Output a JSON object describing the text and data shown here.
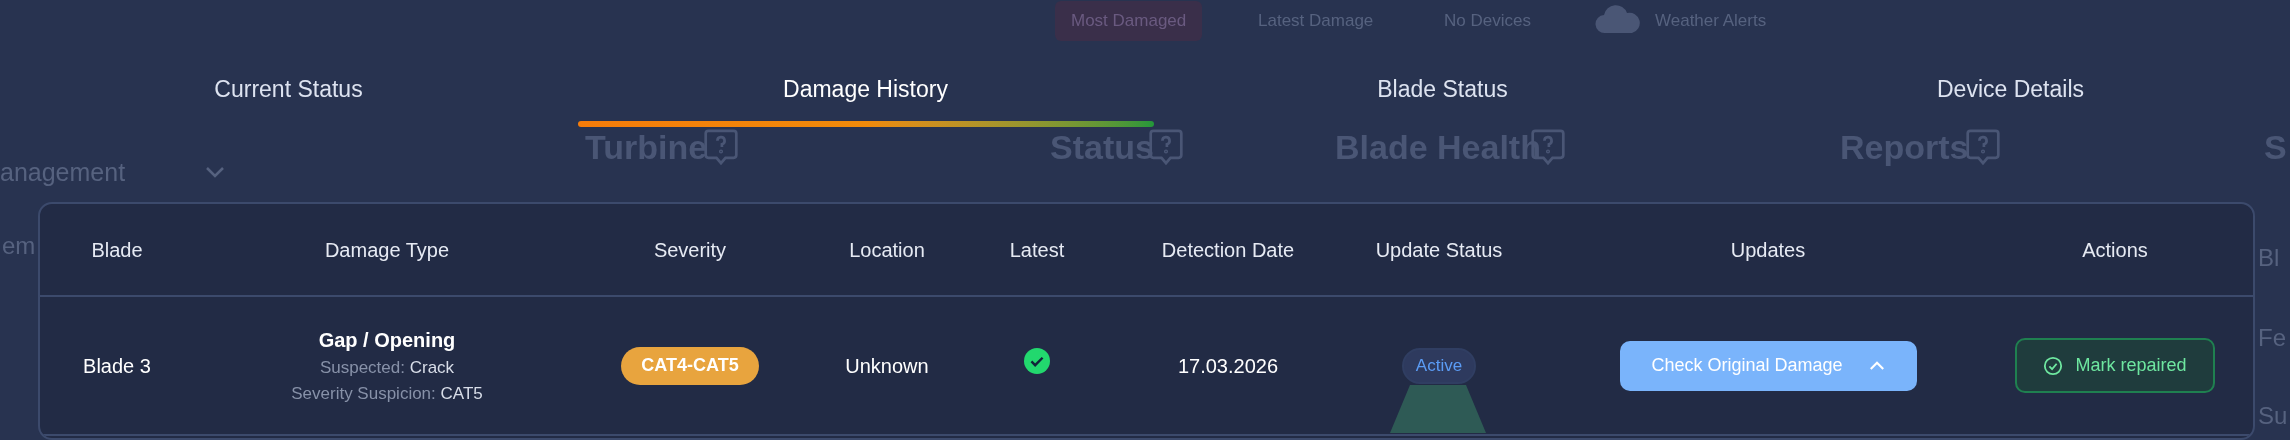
{
  "background": {
    "filters": [
      {
        "label": "Most Damaged",
        "selected": true
      },
      {
        "label": "Latest Damage",
        "selected": false
      },
      {
        "label": "No Devices",
        "selected": false
      },
      {
        "label": "Weather Alerts",
        "selected": false,
        "kind": "weather"
      }
    ],
    "headings": [
      "Turbine",
      "Status",
      "Blade Health",
      "Reports",
      "S"
    ],
    "menu_label": "anagement",
    "fragments": [
      "em",
      "Bl",
      "Fe",
      "Su"
    ]
  },
  "tabs": [
    {
      "label": "Current Status",
      "selected": false
    },
    {
      "label": "Damage History",
      "selected": true
    },
    {
      "label": "Blade Status",
      "selected": false
    },
    {
      "label": "Device Details",
      "selected": false
    }
  ],
  "table": {
    "columns": [
      "Blade",
      "Damage Type",
      "Severity",
      "Location",
      "Latest",
      "Detection Date",
      "Update Status",
      "Updates",
      "Actions"
    ],
    "rows": [
      {
        "blade": "Blade 3",
        "damage_type": "Gap / Opening",
        "details": [
          {
            "label": "Suspected:",
            "value": "Crack"
          },
          {
            "label": "Severity Suspicion:",
            "value": "CAT5"
          }
        ],
        "severity": "CAT4-CAT5",
        "location": "Unknown",
        "latest": true,
        "detection_date": "17.03.2026",
        "update_status": "Active",
        "updates_button": "Check Original Damage",
        "updates_expanded": true,
        "action": "Mark repaired"
      }
    ]
  }
}
